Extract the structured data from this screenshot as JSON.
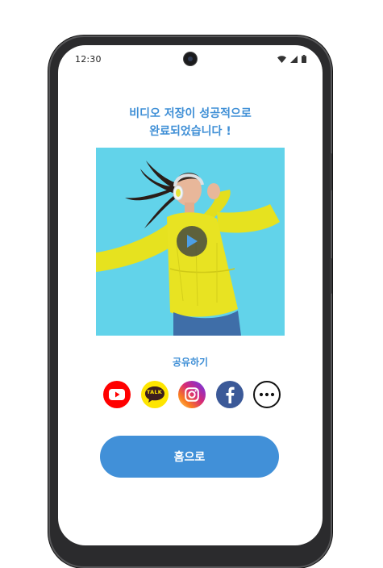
{
  "status_bar": {
    "time": "12:30"
  },
  "title": {
    "line1": "비디오 저장이 성공적으로",
    "line2": "완료되었습니다 !"
  },
  "video": {
    "play_icon": "play-icon"
  },
  "share": {
    "label": "공유하기",
    "buttons": [
      {
        "name": "youtube",
        "icon": "youtube-icon",
        "color": "#ff0000"
      },
      {
        "name": "kakaotalk",
        "icon": "kakaotalk-icon",
        "color": "#fee500",
        "text": "TALK"
      },
      {
        "name": "instagram",
        "icon": "instagram-icon",
        "color": "#d62976"
      },
      {
        "name": "facebook",
        "icon": "facebook-icon",
        "color": "#3b5998"
      },
      {
        "name": "more",
        "icon": "more-icon",
        "color": "#000000"
      }
    ]
  },
  "home_button": {
    "label": "홈으로"
  },
  "colors": {
    "accent": "#4190d8",
    "title": "#3f8fd6"
  }
}
